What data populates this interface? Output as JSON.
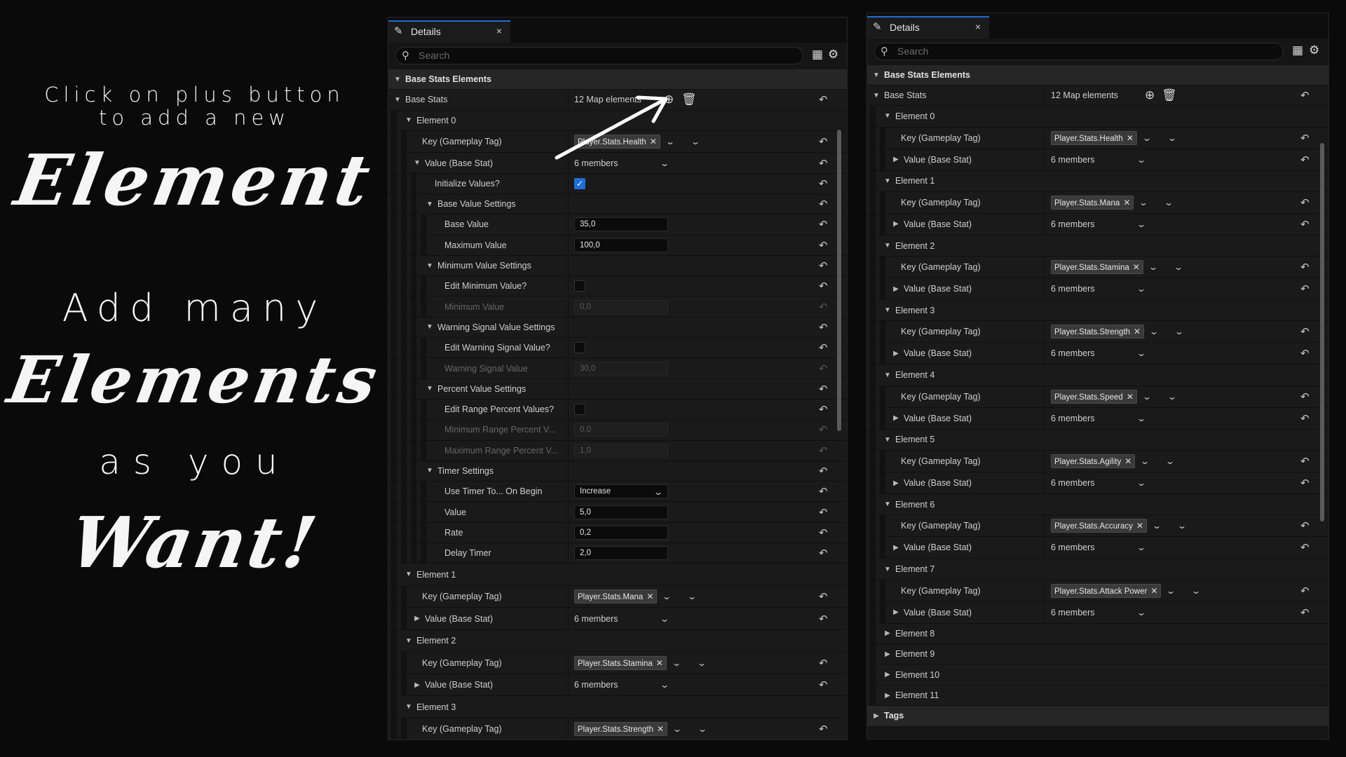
{
  "promo": {
    "line1": "Click on plus button",
    "line2": "to add a new",
    "element": "Element",
    "add_many": "Add many",
    "elements": "Elements",
    "as_you": "as you",
    "want": "Want!"
  },
  "left_panel": {
    "tab_title": "Details",
    "close": "×",
    "search_placeholder": "Search",
    "category": "Base Stats Elements",
    "base_stats_label": "Base Stats",
    "base_stats_value": "12 Map elements",
    "rows": [
      {
        "label": "Element 0"
      },
      {
        "label": "Key (Gameplay Tag)",
        "tag": "Player.Stats.Health"
      },
      {
        "label": "Value (Base Stat)",
        "value": "6 members"
      },
      {
        "label": "Initialize Values?"
      },
      {
        "label": "Base Value Settings"
      },
      {
        "label": "Base Value",
        "value": "35,0"
      },
      {
        "label": "Maximum Value",
        "value": "100,0"
      },
      {
        "label": "Minimum Value Settings"
      },
      {
        "label": "Edit Minimum Value?"
      },
      {
        "label": "Minimum Value",
        "value": "0,0"
      },
      {
        "label": "Warning Signal Value Settings"
      },
      {
        "label": "Edit Warning Signal Value?"
      },
      {
        "label": "Warning Signal Value",
        "value": "30,0"
      },
      {
        "label": "Percent Value Settings"
      },
      {
        "label": "Edit Range Percent Values?"
      },
      {
        "label": "Minimum Range Percent V...",
        "value": "0,0"
      },
      {
        "label": "Maximum Range Percent V...",
        "value": "1,0"
      },
      {
        "label": "Timer Settings"
      },
      {
        "label": "Use Timer To... On Begin",
        "value": "Increase"
      },
      {
        "label": "Value",
        "value": "5,0"
      },
      {
        "label": "Rate",
        "value": "0,2"
      },
      {
        "label": "Delay Timer",
        "value": "2,0"
      },
      {
        "label": "Element 1"
      },
      {
        "label": "Key (Gameplay Tag)",
        "tag": "Player.Stats.Mana"
      },
      {
        "label": "Value (Base Stat)",
        "value": "6 members"
      },
      {
        "label": "Element 2"
      },
      {
        "label": "Key (Gameplay Tag)",
        "tag": "Player.Stats.Stamina"
      },
      {
        "label": "Value (Base Stat)",
        "value": "6 members"
      },
      {
        "label": "Element 3"
      },
      {
        "label": "Key (Gameplay Tag)",
        "tag": "Player.Stats.Strength"
      }
    ]
  },
  "right_panel": {
    "tab_title": "Details",
    "close": "×",
    "search_placeholder": "Search",
    "category": "Base Stats Elements",
    "base_stats_label": "Base Stats",
    "base_stats_value": "12 Map elements",
    "elements": [
      {
        "label": "Element 0",
        "key_label": "Key (Gameplay Tag)",
        "tag": "Player.Stats.Health",
        "value_label": "Value (Base Stat)",
        "value": "6 members"
      },
      {
        "label": "Element 1",
        "key_label": "Key (Gameplay Tag)",
        "tag": "Player.Stats.Mana",
        "value_label": "Value (Base Stat)",
        "value": "6 members"
      },
      {
        "label": "Element 2",
        "key_label": "Key (Gameplay Tag)",
        "tag": "Player.Stats.Stamina",
        "value_label": "Value (Base Stat)",
        "value": "6 members"
      },
      {
        "label": "Element 3",
        "key_label": "Key (Gameplay Tag)",
        "tag": "Player.Stats.Strength",
        "value_label": "Value (Base Stat)",
        "value": "6 members"
      },
      {
        "label": "Element 4",
        "key_label": "Key (Gameplay Tag)",
        "tag": "Player.Stats.Speed",
        "value_label": "Value (Base Stat)",
        "value": "6 members"
      },
      {
        "label": "Element 5",
        "key_label": "Key (Gameplay Tag)",
        "tag": "Player.Stats.Agility",
        "value_label": "Value (Base Stat)",
        "value": "6 members"
      },
      {
        "label": "Element 6",
        "key_label": "Key (Gameplay Tag)",
        "tag": "Player.Stats.Accuracy",
        "value_label": "Value (Base Stat)",
        "value": "6 members"
      },
      {
        "label": "Element 7",
        "key_label": "Key (Gameplay Tag)",
        "tag": "Player.Stats.Attack Power",
        "value_label": "Value (Base Stat)",
        "value": "6 members"
      }
    ],
    "collapsed": [
      "Element 8",
      "Element 9",
      "Element 10",
      "Element 11"
    ],
    "tags_label": "Tags"
  },
  "icons": {
    "tab": "pencil-icon",
    "search": "search-icon",
    "table": "table-view-icon",
    "settings": "gear-icon",
    "add": "add-element-icon",
    "delete": "trash-icon",
    "reset": "reset-arrow-icon",
    "clear_tag": "clear-tag-icon",
    "expand": "expand-triangle-icon"
  },
  "colors": {
    "accent": "#1e6fd6",
    "background": "#0a0a0a",
    "panel": "#151515"
  }
}
